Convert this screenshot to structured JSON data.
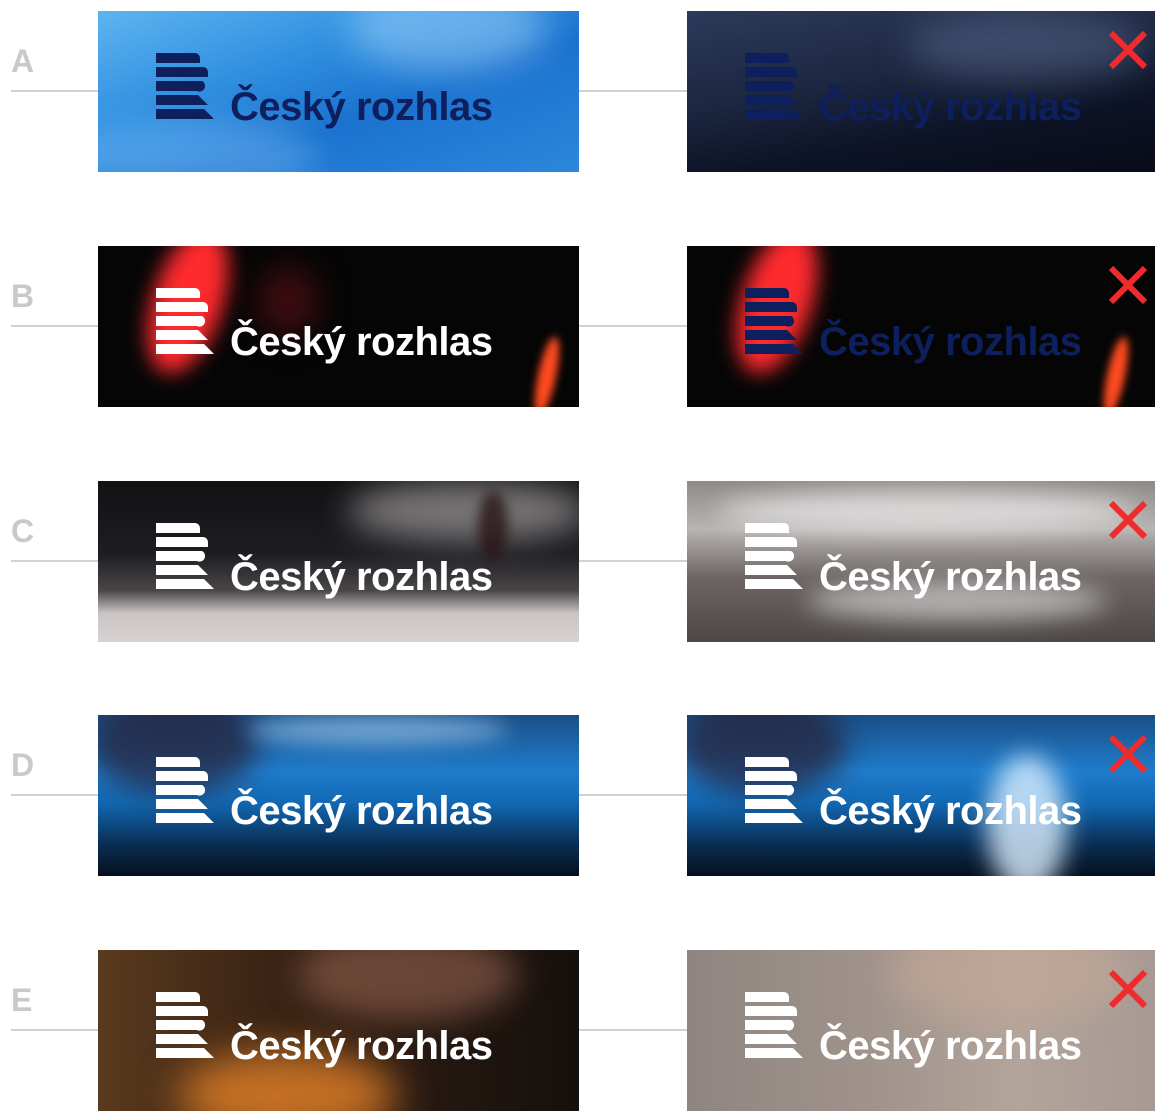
{
  "brand": {
    "wordmark": "Český rozhlas",
    "colors": {
      "navy": "#0d1f5c",
      "white": "#ffffff",
      "red_cross": "#ef2b2d",
      "guide": "#d2d2d2",
      "letter": "#c9c9c9"
    }
  },
  "rows": [
    {
      "letter": "A",
      "good": {
        "mark_color": "#0d1f5c",
        "text_color": "#0d1f5c"
      },
      "bad": {
        "mark_color": "#0d1f5c",
        "text_color": "#0d1f5c",
        "icon": "cross-icon"
      }
    },
    {
      "letter": "B",
      "good": {
        "mark_color": "#ffffff",
        "text_color": "#ffffff"
      },
      "bad": {
        "mark_color": "#0d1f5c",
        "text_color": "#0d1f5c",
        "icon": "cross-icon"
      }
    },
    {
      "letter": "C",
      "good": {
        "mark_color": "#ffffff",
        "text_color": "#ffffff"
      },
      "bad": {
        "mark_color": "#ffffff",
        "text_color": "#ffffff",
        "icon": "cross-icon"
      }
    },
    {
      "letter": "D",
      "good": {
        "mark_color": "#ffffff",
        "text_color": "#ffffff"
      },
      "bad": {
        "mark_color": "#ffffff",
        "text_color": "#ffffff",
        "icon": "cross-icon"
      }
    },
    {
      "letter": "E",
      "good": {
        "mark_color": "#ffffff",
        "text_color": "#ffffff"
      },
      "bad": {
        "mark_color": "#ffffff",
        "text_color": "#ffffff",
        "icon": "cross-icon"
      }
    }
  ]
}
